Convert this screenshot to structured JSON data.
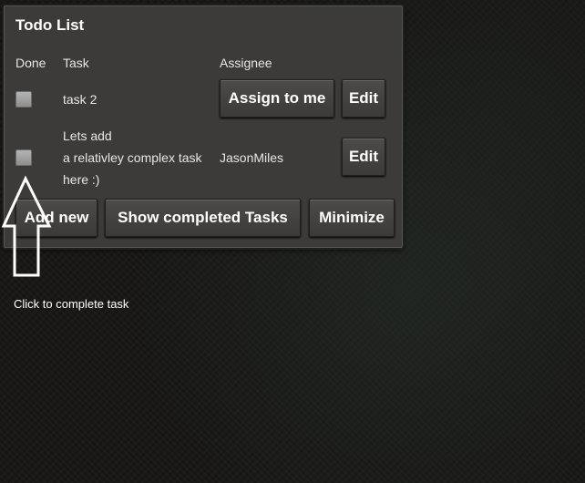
{
  "panel": {
    "title": "Todo List",
    "headers": {
      "done": "Done",
      "task": "Task",
      "assignee": "Assignee"
    },
    "tasks": [
      {
        "done": false,
        "task_lines": [
          "task 2"
        ],
        "assignee": "",
        "assign_label": "Assign to me",
        "edit_label": "Edit"
      },
      {
        "done": false,
        "task_lines": [
          "Lets add",
          "a relativley complex task",
          "here :)"
        ],
        "assignee": "JasonMiles",
        "edit_label": "Edit"
      }
    ],
    "footer": {
      "add_new_label": "Add new",
      "show_completed_label": "Show completed Tasks",
      "minimize_label": "Minimize"
    }
  },
  "annotation": {
    "text": "Click to complete task",
    "icon": "arrow-up-icon"
  },
  "colors": {
    "panel_bg": "#3c3b3a",
    "button_bg": "#454443",
    "text": "#ffffff",
    "page_bg": "#161513"
  }
}
